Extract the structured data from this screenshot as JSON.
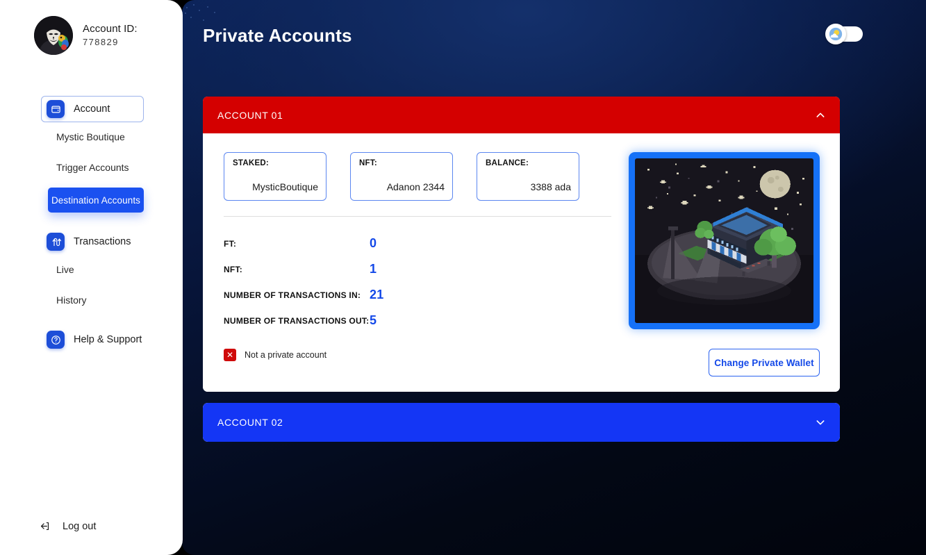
{
  "app": {
    "accent_blue": "#1348e8",
    "danger_red": "#d40000",
    "sidebar_bg": "#ffffff"
  },
  "sidebar": {
    "profile": {
      "avatar_icon": "anonymous-mask-avatar",
      "title": "Account ID:",
      "id": "778829"
    },
    "nav": [
      {
        "label": "Account",
        "icon": "wallet-icon",
        "type": "main",
        "active": true
      },
      {
        "label": "Mystic Boutique",
        "type": "sub",
        "active": false
      },
      {
        "label": "Trigger Accounts",
        "type": "sub",
        "active": false
      },
      {
        "label": "Destination Accounts",
        "type": "pill",
        "active": true
      },
      {
        "label": "Transactions",
        "icon": "transfer-arrows-icon",
        "type": "main",
        "active": false
      },
      {
        "label": "Live",
        "type": "sub",
        "active": false
      },
      {
        "label": "History",
        "type": "sub",
        "active": false
      },
      {
        "label": "Help & Support",
        "icon": "question-circle-icon",
        "type": "main",
        "active": false
      }
    ],
    "logout": {
      "label": "Log out",
      "icon": "logout-arrow-icon"
    }
  },
  "header": {
    "title": "Private Accounts",
    "theme_toggle": {
      "icon": "sun-cloud-icon",
      "state": "light",
      "knob_side": "left"
    }
  },
  "accounts": [
    {
      "title": "ACCOUNT 01",
      "header_color": "#d40000",
      "expanded": true,
      "chevron_icon": "chevron-up-icon",
      "info_boxes": [
        {
          "key": "STAKED:",
          "value": "MysticBoutique"
        },
        {
          "key": "NFT:",
          "value": "Adanon 2344"
        },
        {
          "key": "BALANCE:",
          "value": "3388 ada"
        }
      ],
      "stats": [
        {
          "key": "FT:",
          "value": "0"
        },
        {
          "key": "NFT:",
          "value": "1"
        },
        {
          "key": "NUMBER OF TRANSACTIONS IN:",
          "value": "21"
        },
        {
          "key": "NUMBER OF TRANSACTIONS OUT:",
          "value": "5"
        }
      ],
      "status": {
        "icon": "x-mark-icon",
        "text": "Not a private account"
      },
      "action": {
        "label": "Change Private Wallet"
      },
      "nft_art": {
        "name": "pixel-art-night-shop-scene"
      }
    },
    {
      "title": "ACCOUNT 02",
      "header_color": "#1436f5",
      "expanded": false,
      "chevron_icon": "chevron-down-icon"
    }
  ]
}
